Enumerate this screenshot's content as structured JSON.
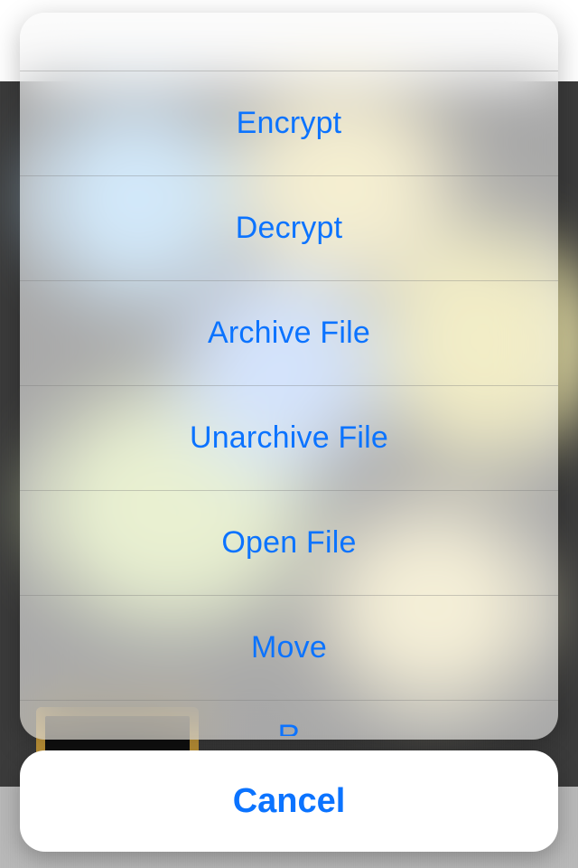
{
  "actionSheet": {
    "options": [
      "Encrypt",
      "Decrypt",
      "Archive File",
      "Unarchive File",
      "Open File",
      "Move"
    ],
    "partial_next": "R",
    "cancel": "Cancel"
  },
  "colors": {
    "accent": "#0b73ff"
  }
}
